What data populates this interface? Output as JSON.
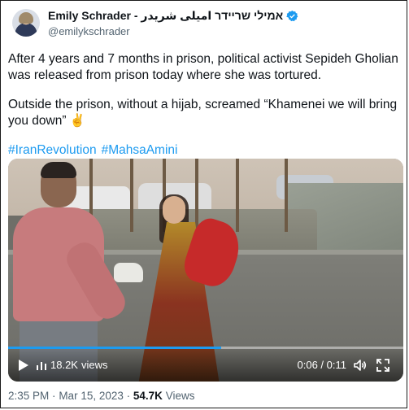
{
  "tweet": {
    "display_name": "Emily Schrader - אמילי שריידר امیلی شریدر",
    "handle": "@emilykschrader",
    "verified": true,
    "text_paragraph_1": "After 4 years and 7 months in prison, political activist Sepideh Gholian was released from prison today where she was tortured.",
    "text_paragraph_2": "Outside the prison, without a hijab, screamed “Khamenei we will bring you down” ✌️",
    "hashtags": [
      "#IranRevolution",
      "#MahsaAmini"
    ],
    "hashtag_color": "#1d9bf0"
  },
  "video": {
    "views_count": "18.2K",
    "views_label": "views",
    "time": "0:06 / 0:11",
    "progress_fraction": 0.54,
    "progress_color": "#1d9bf0",
    "play_icon": "play-icon",
    "volume_icon": "volume-icon",
    "fullscreen_icon": "fullscreen-icon"
  },
  "footer": {
    "time": "2:35 PM",
    "separator": "·",
    "date": "Mar 15, 2023",
    "views_count": "54.7K",
    "views_label": "Views"
  }
}
